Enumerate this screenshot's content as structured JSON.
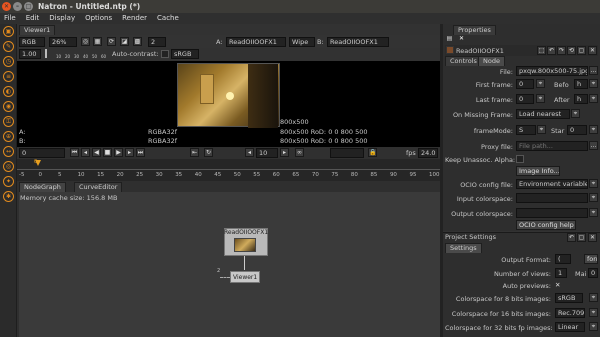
{
  "window": {
    "title": "Natron - Untitled.ntp (*)"
  },
  "menu": [
    "File",
    "Edit",
    "Display",
    "Options",
    "Render",
    "Cache"
  ],
  "viewer": {
    "tab": "Viewer1",
    "channels": "RGB",
    "zoom": "26%",
    "layer_count": "2",
    "gain": "1.00",
    "ruler_ticks": [
      "10",
      "20",
      "30",
      "40",
      "50",
      "60",
      "70",
      "80",
      "90",
      "100"
    ],
    "auto_contrast": "Auto-contrast:",
    "colorspace": "sRGB",
    "input_a_label": "A:",
    "input_a": "ReadOIIOOFX1",
    "composite": "Wipe",
    "input_b_label": "B:",
    "input_b": "ReadOIIOOFX1",
    "format_label": "800x500",
    "info_a": {
      "label": "A:",
      "format": "RGBA32f",
      "rod": "800x500 RoD: 0 0 800 500"
    },
    "info_b": {
      "label": "B:",
      "format": "RGBA32f",
      "rod": "800x500 RoD: 0 0 800 500"
    },
    "frame": "0",
    "frame_increment": "10",
    "fps_label": "fps",
    "fps": "24.0",
    "timeline_ticks": [
      "-5",
      "0",
      "5",
      "10",
      "15",
      "20",
      "25",
      "30",
      "35",
      "40",
      "45",
      "50",
      "55",
      "60",
      "65",
      "70",
      "75",
      "80",
      "85",
      "90",
      "95",
      "100"
    ],
    "current_frame_marker": "0"
  },
  "nodegraph": {
    "tabs": [
      "NodeGraph",
      "CurveEditor"
    ],
    "memory": "Memory cache size: 156.8 MB",
    "read_node": "ReadOIIOOFX1",
    "viewer_node": "Viewer1",
    "input_num": "2"
  },
  "properties": {
    "tab": "Properties",
    "node_name": "ReadOIIOOFX1",
    "tabs": [
      "Controls",
      "Node"
    ],
    "file_label": "File:",
    "file": "pxqw.800x500-75.jpg",
    "first_frame_label": "First frame:",
    "first_frame": "0",
    "before_label": "Befo",
    "before_value": "h",
    "last_frame_label": "Last frame:",
    "last_frame": "0",
    "after_label": "After",
    "after_value": "h",
    "missing_label": "On Missing Frame:",
    "missing": "Load nearest",
    "framemode_label": "frameMode:",
    "framemode": "S",
    "start_label": "Star",
    "start_value": "0",
    "proxy_label": "Proxy file:",
    "proxy_placeholder": "File path...",
    "keep_label": "Keep Unassoc. Alpha:",
    "image_info": "Image Info...",
    "ocio_label": "OCIO config file:",
    "ocio": "Environment variable",
    "input_cs_label": "Input colorspace:",
    "output_cs_label": "Output colorspace:",
    "ocio_help": "OCIO config help"
  },
  "project": {
    "title": "Project Settings",
    "tab": "Settings",
    "output_format_label": "Output Format:",
    "output_format": "(",
    "format_btn": "form",
    "views_label": "Number of views:",
    "views": "1",
    "main_label": "Mai",
    "main_value": "0",
    "auto_previews_label": "Auto previews:",
    "auto_previews_mark": "✕",
    "cs8_label": "Colorspace for 8 bits images:",
    "cs8": "sRGB",
    "cs16_label": "Colorspace for 16 bits images:",
    "cs16": "Rec.709",
    "cs32_label": "Colorspace for 32 bits fp images:",
    "cs32": "Linear"
  },
  "colors": {
    "accent": "#e08a1e",
    "viewer_bg": "#000000",
    "frame_marker": "#e8a020"
  }
}
